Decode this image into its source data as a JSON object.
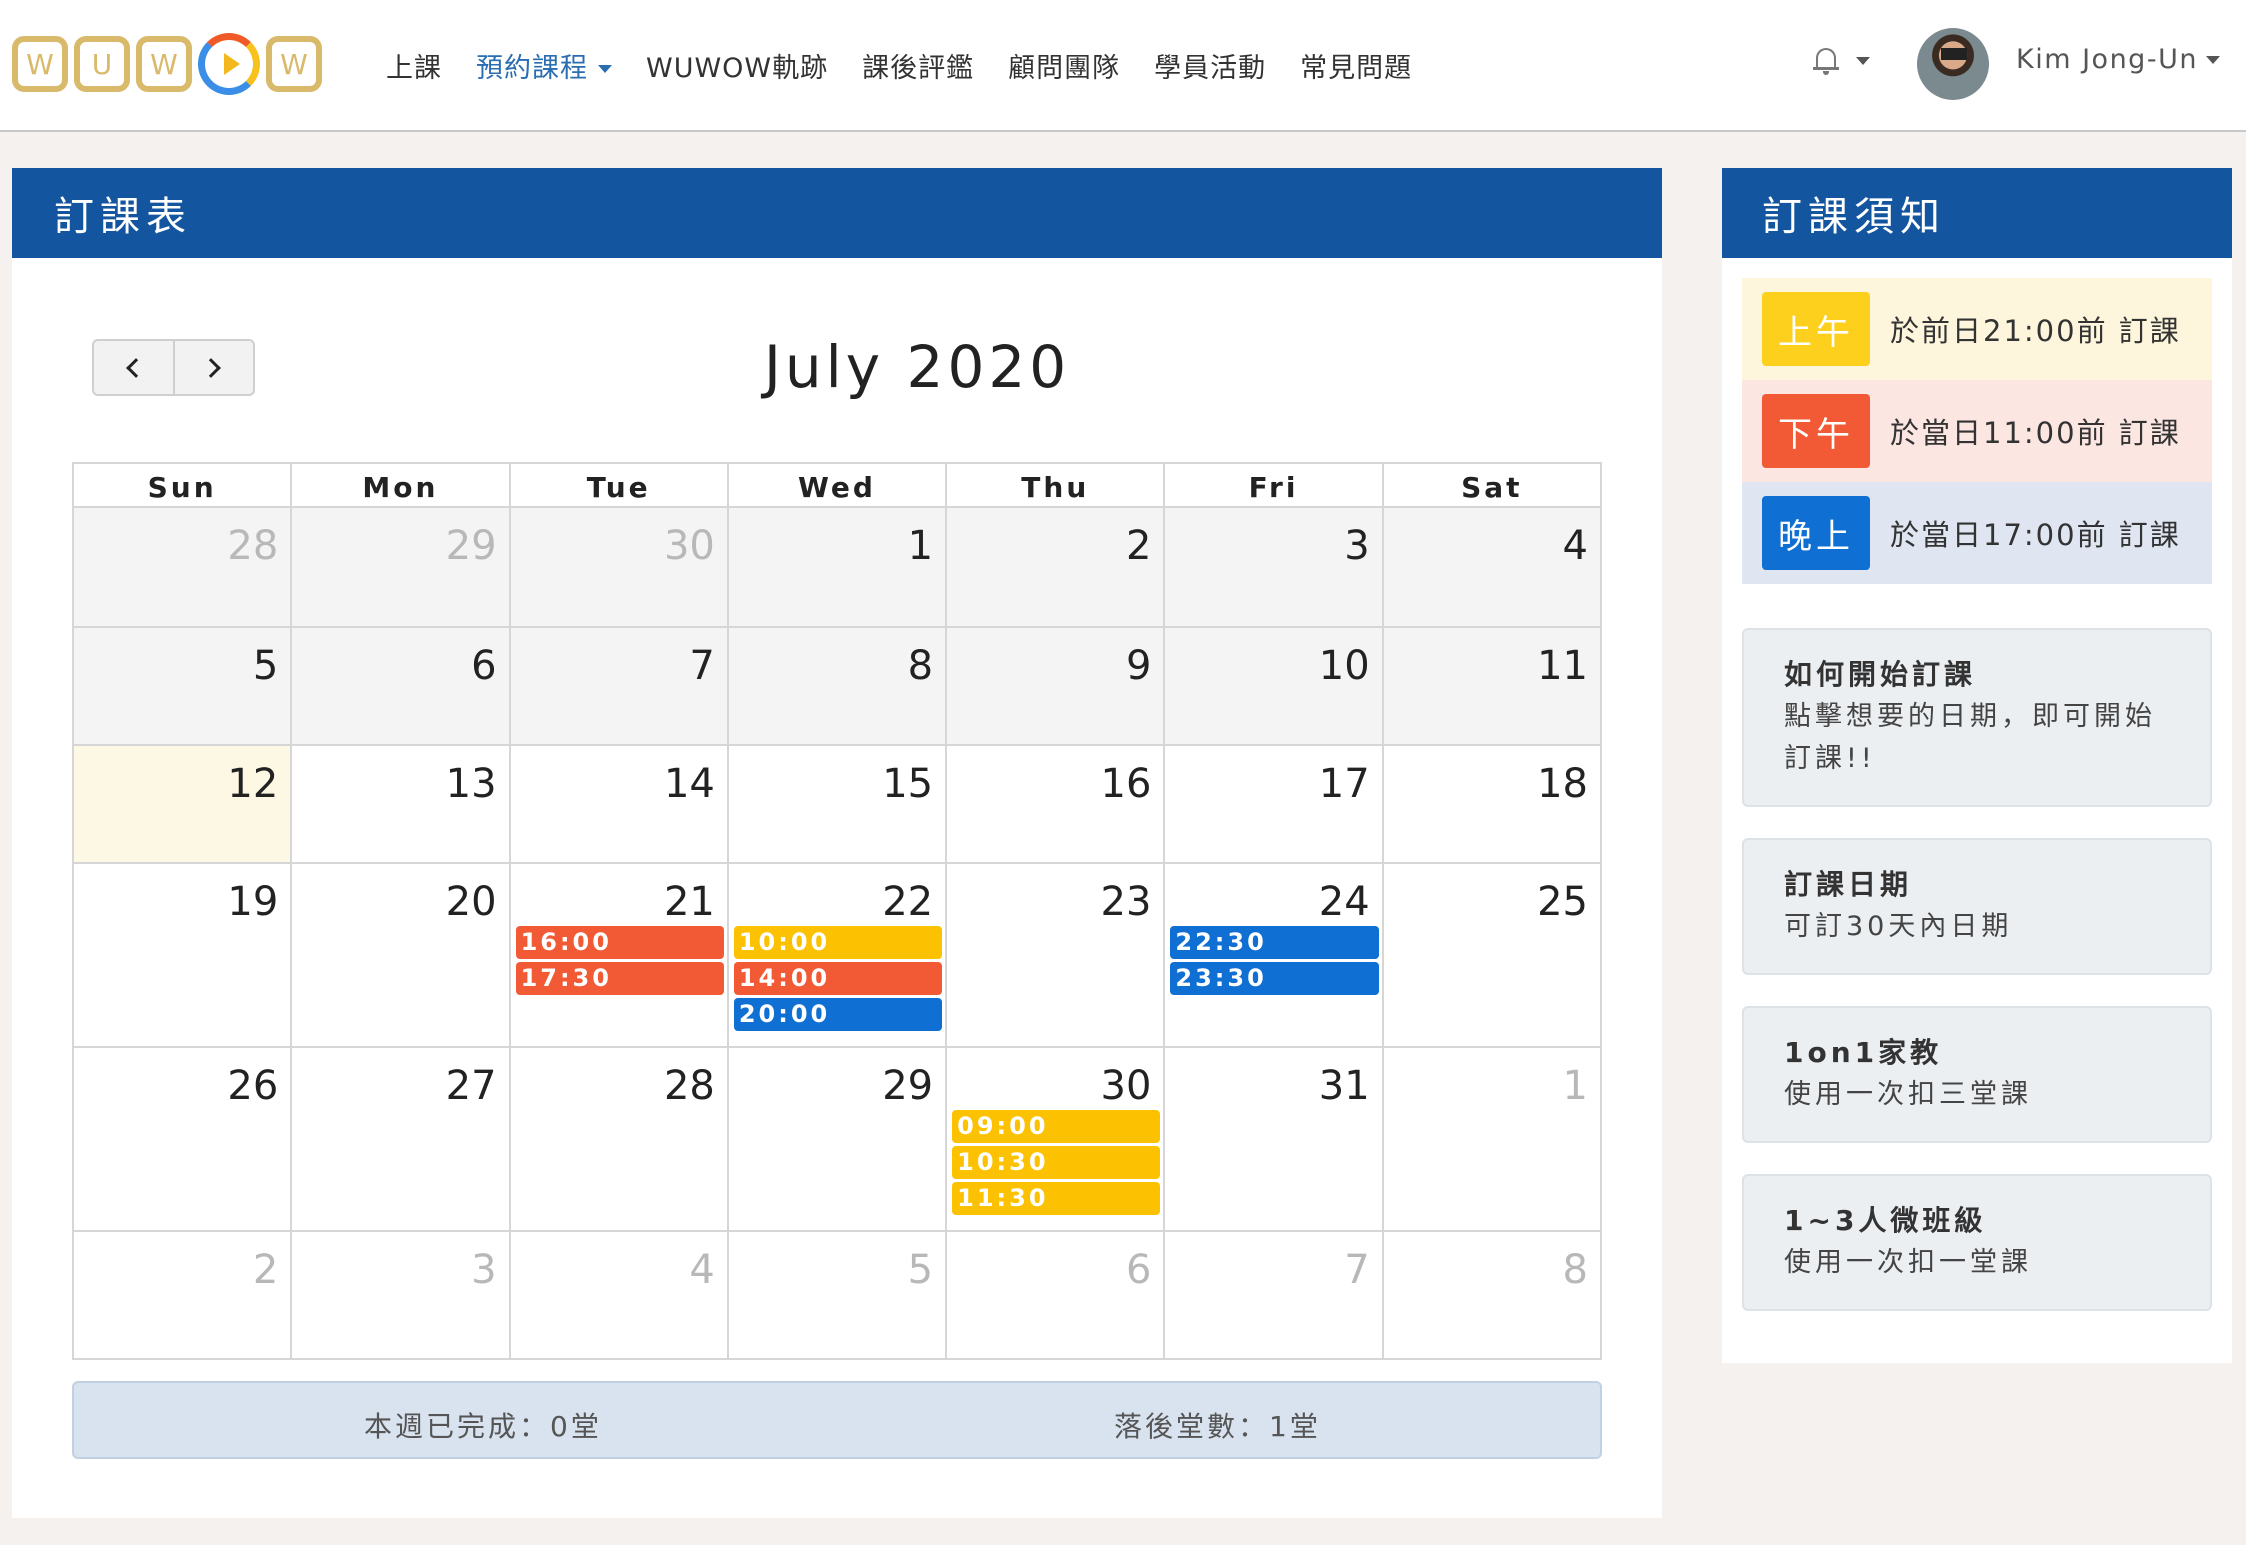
{
  "header": {
    "logo_letters": [
      "W",
      "U",
      "W",
      "W"
    ],
    "nav": [
      {
        "label": "上課",
        "active": false,
        "dropdown": false
      },
      {
        "label": "預約課程",
        "active": true,
        "dropdown": true
      },
      {
        "label": "WUWOW軌跡",
        "active": false,
        "dropdown": false
      },
      {
        "label": "課後評鑑",
        "active": false,
        "dropdown": false
      },
      {
        "label": "顧問團隊",
        "active": false,
        "dropdown": false
      },
      {
        "label": "學員活動",
        "active": false,
        "dropdown": false
      },
      {
        "label": "常見問題",
        "active": false,
        "dropdown": false
      }
    ],
    "user_name": "Kim Jong-Un",
    "icons": {
      "notification": "bell-icon",
      "dropdown": "caret-down-icon"
    }
  },
  "booking": {
    "panel_title": "訂課表",
    "month_title": "July 2020",
    "weekdays": [
      "Sun",
      "Mon",
      "Tue",
      "Wed",
      "Thu",
      "Fri",
      "Sat"
    ],
    "weeks": [
      [
        {
          "day": "28",
          "other": true,
          "past": true,
          "events": []
        },
        {
          "day": "29",
          "other": true,
          "past": true,
          "events": []
        },
        {
          "day": "30",
          "other": true,
          "past": true,
          "events": []
        },
        {
          "day": "1",
          "past": true,
          "events": []
        },
        {
          "day": "2",
          "past": true,
          "events": []
        },
        {
          "day": "3",
          "past": true,
          "events": []
        },
        {
          "day": "4",
          "past": true,
          "events": []
        }
      ],
      [
        {
          "day": "5",
          "past": true,
          "events": []
        },
        {
          "day": "6",
          "past": true,
          "events": []
        },
        {
          "day": "7",
          "past": true,
          "events": []
        },
        {
          "day": "8",
          "past": true,
          "events": []
        },
        {
          "day": "9",
          "past": true,
          "events": []
        },
        {
          "day": "10",
          "past": true,
          "events": []
        },
        {
          "day": "11",
          "past": true,
          "events": []
        }
      ],
      [
        {
          "day": "12",
          "today": true,
          "events": []
        },
        {
          "day": "13",
          "events": []
        },
        {
          "day": "14",
          "events": []
        },
        {
          "day": "15",
          "events": []
        },
        {
          "day": "16",
          "events": []
        },
        {
          "day": "17",
          "events": []
        },
        {
          "day": "18",
          "events": []
        }
      ],
      [
        {
          "day": "19",
          "events": []
        },
        {
          "day": "20",
          "events": []
        },
        {
          "day": "21",
          "events": [
            {
              "time": "16:00",
              "slot": "pm"
            },
            {
              "time": "17:30",
              "slot": "pm"
            }
          ]
        },
        {
          "day": "22",
          "events": [
            {
              "time": "10:00",
              "slot": "am"
            },
            {
              "time": "14:00",
              "slot": "pm"
            },
            {
              "time": "20:00",
              "slot": "ev"
            }
          ]
        },
        {
          "day": "23",
          "events": []
        },
        {
          "day": "24",
          "events": [
            {
              "time": "22:30",
              "slot": "ev"
            },
            {
              "time": "23:30",
              "slot": "ev"
            }
          ]
        },
        {
          "day": "25",
          "events": []
        }
      ],
      [
        {
          "day": "26",
          "events": []
        },
        {
          "day": "27",
          "events": []
        },
        {
          "day": "28",
          "events": []
        },
        {
          "day": "29",
          "events": []
        },
        {
          "day": "30",
          "events": [
            {
              "time": "09:00",
              "slot": "am"
            },
            {
              "time": "10:30",
              "slot": "am"
            },
            {
              "time": "11:30",
              "slot": "am"
            }
          ]
        },
        {
          "day": "31",
          "events": []
        },
        {
          "day": "1",
          "other": true,
          "events": []
        }
      ],
      [
        {
          "day": "2",
          "other": true,
          "events": []
        },
        {
          "day": "3",
          "other": true,
          "events": []
        },
        {
          "day": "4",
          "other": true,
          "events": []
        },
        {
          "day": "5",
          "other": true,
          "events": []
        },
        {
          "day": "6",
          "other": true,
          "events": []
        },
        {
          "day": "7",
          "other": true,
          "events": []
        },
        {
          "day": "8",
          "other": true,
          "events": []
        }
      ]
    ],
    "summary": {
      "completed": "本週已完成：0堂",
      "behind": "落後堂數：1堂"
    }
  },
  "notice": {
    "panel_title": "訂課須知",
    "rules": [
      {
        "badge": "上午",
        "text": "於前日21:00前 訂課",
        "badge_color": "#fcd01c",
        "row_color": "#fdf6dc"
      },
      {
        "badge": "下午",
        "text": "於當日11:00前 訂課",
        "badge_color": "#f15a35",
        "row_color": "#fbe6e2"
      },
      {
        "badge": "晚上",
        "text": "於當日17:00前 訂課",
        "badge_color": "#0f6fd3",
        "row_color": "#dfe6f2"
      }
    ],
    "info": [
      {
        "title": "如何開始訂課",
        "body": "點擊想要的日期，即可開始訂課!!"
      },
      {
        "title": "訂課日期",
        "body": "可訂30天內日期"
      },
      {
        "title": "1on1家教",
        "body": "使用一次扣三堂課"
      },
      {
        "title": "1~3人微班級",
        "body": "使用一次扣一堂課"
      }
    ]
  },
  "colors": {
    "brand": "#13559f",
    "morning": "#fcc100",
    "afternoon": "#f15a35",
    "evening": "#0f6fd3",
    "today": "#fcf8e3",
    "logo_gold": "#d9b96a"
  }
}
